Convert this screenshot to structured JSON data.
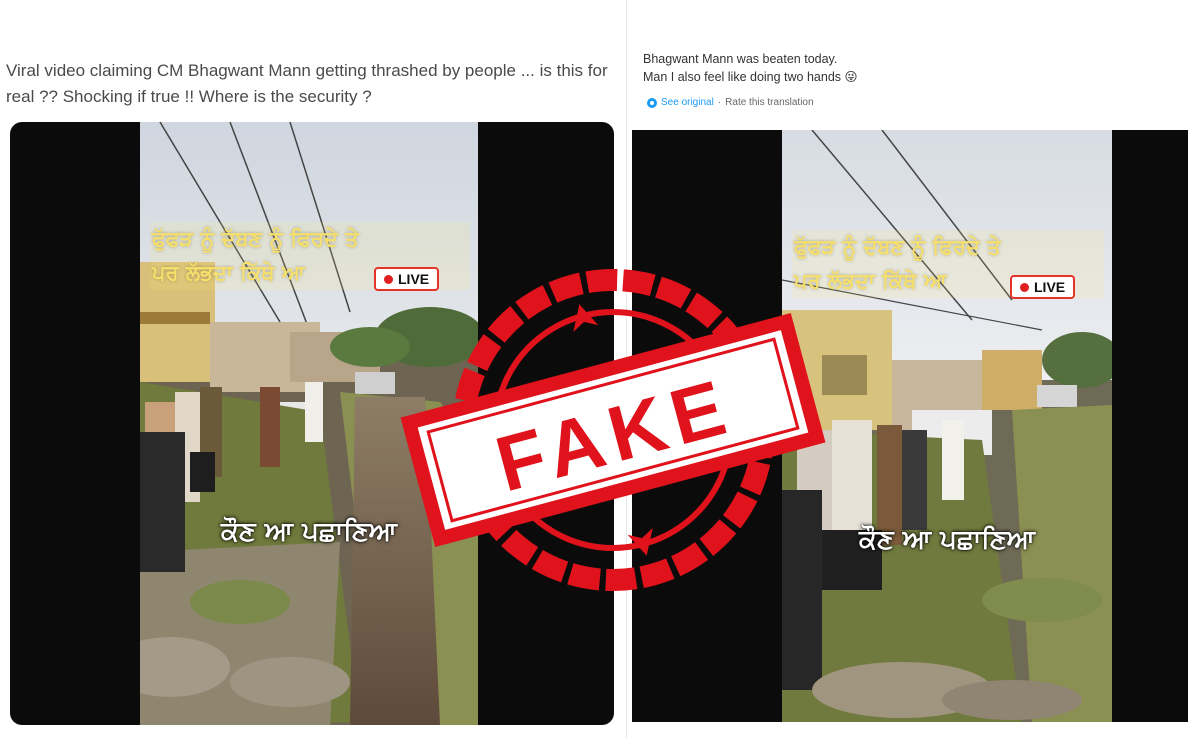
{
  "left_post": {
    "text": "Viral video claiming CM Bhagwant Mann  getting thrashed by people ... is this for real ?? Shocking if true !! Where is the security ?"
  },
  "right_post": {
    "line1": "Bhagwant Mann was beaten today.",
    "line2": "Man I also feel like doing two hands 😜",
    "see_original": "See original",
    "separator": "·",
    "rate_translation": "Rate this translation"
  },
  "video": {
    "overlay_line1": "ਫੁੱਫੜ ਨੂੰ ਦੱਬਣ ਨੂੰ ਫਿਰਦੇ ਤੇ",
    "overlay_line2": "ਪਰ ਲੱਭਦਾ ਕਿੱਥੇ ਆ",
    "live_label": "LIVE",
    "caption": "ਕੌਣ ਆ ਪਛਾਣਿਆ"
  },
  "stamp": {
    "label": "FAKE",
    "color": "#e0121b"
  },
  "colors": {
    "overlay_yellow": "#f6df6a",
    "live_border": "#e6332a",
    "link_blue": "#1d9bf0"
  }
}
